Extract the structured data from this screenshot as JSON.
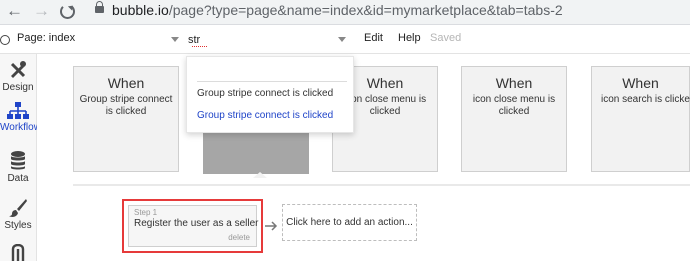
{
  "browser": {
    "url_host": "bubble.io",
    "url_path": "/page?type=page&name=index&id=mymarketplace&tab=tabs-2"
  },
  "toolbar": {
    "page_select": "Page: index",
    "search_value": "str",
    "menu": {
      "edit": "Edit",
      "help": "Help",
      "saved": "Saved"
    }
  },
  "sidebar": {
    "items": [
      {
        "label": "Design",
        "icon": "tools-icon"
      },
      {
        "label": "Workflow",
        "icon": "sitemap-icon"
      },
      {
        "label": "Data",
        "icon": "database-icon"
      },
      {
        "label": "Styles",
        "icon": "brush-icon"
      },
      {
        "label": "",
        "icon": "plug-icon"
      }
    ]
  },
  "events": [
    {
      "when": "When",
      "desc": "Group stripe connect is clicked"
    },
    {
      "when": "When",
      "desc": "icon close menu is clicked"
    },
    {
      "when": "When",
      "desc": "icon close menu is clicked"
    },
    {
      "when": "When",
      "desc": "icon search is clicked"
    }
  ],
  "dropdown": {
    "items": [
      "Group stripe connect is clicked",
      "Group stripe connect is clicked"
    ]
  },
  "workflow": {
    "step_number": "Step 1",
    "step_title": "Register the user as a seller",
    "step_delete": "delete",
    "add_action": "Click here to add an action..."
  },
  "colors": {
    "accent": "#1f44c8",
    "highlight_border": "#e63a3a"
  }
}
